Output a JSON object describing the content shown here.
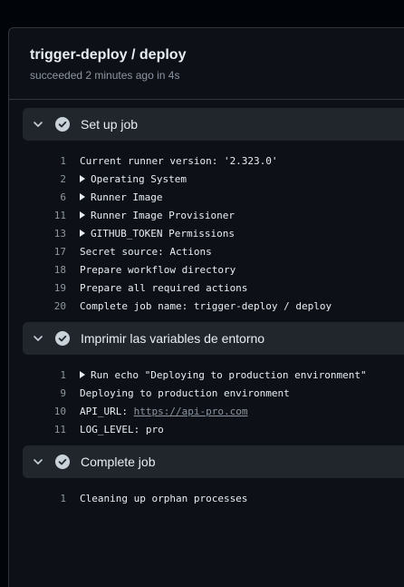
{
  "job": {
    "title": "trigger-deploy / deploy",
    "subtitle": "succeeded 2 minutes ago in 4s"
  },
  "steps": [
    {
      "title": "Set up job",
      "lines": [
        {
          "num": "1",
          "text": "Current runner version: '2.323.0'",
          "expandable": false
        },
        {
          "num": "2",
          "text": "Operating System",
          "expandable": true
        },
        {
          "num": "6",
          "text": "Runner Image",
          "expandable": true
        },
        {
          "num": "11",
          "text": "Runner Image Provisioner",
          "expandable": true
        },
        {
          "num": "13",
          "text": "GITHUB_TOKEN Permissions",
          "expandable": true
        },
        {
          "num": "17",
          "text": "Secret source: Actions",
          "expandable": false
        },
        {
          "num": "18",
          "text": "Prepare workflow directory",
          "expandable": false
        },
        {
          "num": "19",
          "text": "Prepare all required actions",
          "expandable": false
        },
        {
          "num": "20",
          "text": "Complete job name: trigger-deploy / deploy",
          "expandable": false
        }
      ]
    },
    {
      "title": "Imprimir las variables de entorno",
      "lines": [
        {
          "num": "1",
          "text": "Run echo \"Deploying to production environment\"",
          "expandable": true
        },
        {
          "num": "9",
          "text": "Deploying to production environment",
          "expandable": false
        },
        {
          "num": "10",
          "text": "API_URL: ",
          "link": "https://api-pro.com",
          "expandable": false
        },
        {
          "num": "11",
          "text": "LOG_LEVEL: pro",
          "expandable": false
        }
      ]
    },
    {
      "title": "Complete job",
      "lines": [
        {
          "num": "1",
          "text": "Cleaning up orphan processes",
          "expandable": false
        }
      ]
    }
  ],
  "colors": {
    "background": "#0d1117",
    "step_header": "#21262d",
    "text": "#e6edf3",
    "muted": "#8d96a0",
    "success_icon": "#c9d1d9"
  }
}
